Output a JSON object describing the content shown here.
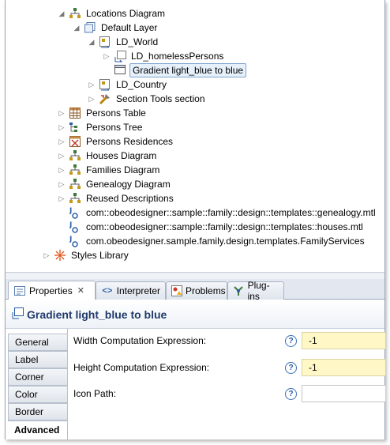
{
  "tree": {
    "items": [
      {
        "label": "Locations Diagram",
        "twisty": "expanded",
        "icon": "diagram-icon"
      },
      {
        "label": "Default Layer",
        "twisty": "expanded",
        "icon": "layer-icon"
      },
      {
        "label": "LD_World",
        "twisty": "expanded",
        "icon": "container-icon"
      },
      {
        "label": "LD_homelessPersons",
        "twisty": "collapsed",
        "icon": "node-icon"
      },
      {
        "label": "Gradient  light_blue to blue",
        "twisty": "none",
        "icon": "gradient-style-icon",
        "selected": true
      },
      {
        "label": "LD_Country",
        "twisty": "collapsed",
        "icon": "container-icon"
      },
      {
        "label": "Section Tools section",
        "twisty": "collapsed",
        "icon": "tools-section-icon"
      },
      {
        "label": "Persons Table",
        "twisty": "collapsed",
        "icon": "table-icon"
      },
      {
        "label": "Persons Tree",
        "twisty": "collapsed",
        "icon": "tree-icon"
      },
      {
        "label": "Persons Residences",
        "twisty": "collapsed",
        "icon": "cross-table-icon"
      },
      {
        "label": "Houses Diagram",
        "twisty": "collapsed",
        "icon": "diagram-icon"
      },
      {
        "label": "Families Diagram",
        "twisty": "collapsed",
        "icon": "diagram-icon"
      },
      {
        "label": "Genealogy Diagram",
        "twisty": "collapsed",
        "icon": "diagram-icon"
      },
      {
        "label": "Reused Descriptions",
        "twisty": "collapsed",
        "icon": "diagram-icon"
      },
      {
        "label": "com::obeodesigner::sample::family::design::templates::genealogy.mtl",
        "twisty": "none",
        "icon": "java-import-icon"
      },
      {
        "label": "com::obeodesigner::sample::family::design::templates::houses.mtl",
        "twisty": "none",
        "icon": "java-import-icon"
      },
      {
        "label": "com.obeodesigner.sample.family.design.templates.FamilyServices",
        "twisty": "none",
        "icon": "java-import-icon"
      },
      {
        "label": "Styles Library",
        "twisty": "collapsed",
        "icon": "styles-library-icon"
      }
    ]
  },
  "tabs": [
    {
      "label": "Properties",
      "active": true,
      "closable": true,
      "icon": "properties-icon"
    },
    {
      "label": "Interpreter",
      "active": false,
      "icon": "interpreter-icon"
    },
    {
      "label": "Problems",
      "active": false,
      "icon": "problems-icon"
    },
    {
      "label": "Plug-ins",
      "active": false,
      "icon": "plugins-icon"
    }
  ],
  "header": {
    "title": "Gradient  light_blue to blue"
  },
  "sidetabs": [
    "General",
    "Label",
    "Corner",
    "Color",
    "Border",
    "Advanced"
  ],
  "active_sidetab": "Advanced",
  "fields": [
    {
      "label": "Width Computation Expression:",
      "value": "-1",
      "highlight": true
    },
    {
      "label": "Height Computation Expression:",
      "value": "-1",
      "highlight": true
    },
    {
      "label": "Icon Path:",
      "value": "",
      "highlight": false
    }
  ],
  "help_glyph": "?",
  "colors": {
    "selection": "#e6f0fb",
    "header_text": "#1f3a6b",
    "field_highlight": "#fff8c6"
  }
}
